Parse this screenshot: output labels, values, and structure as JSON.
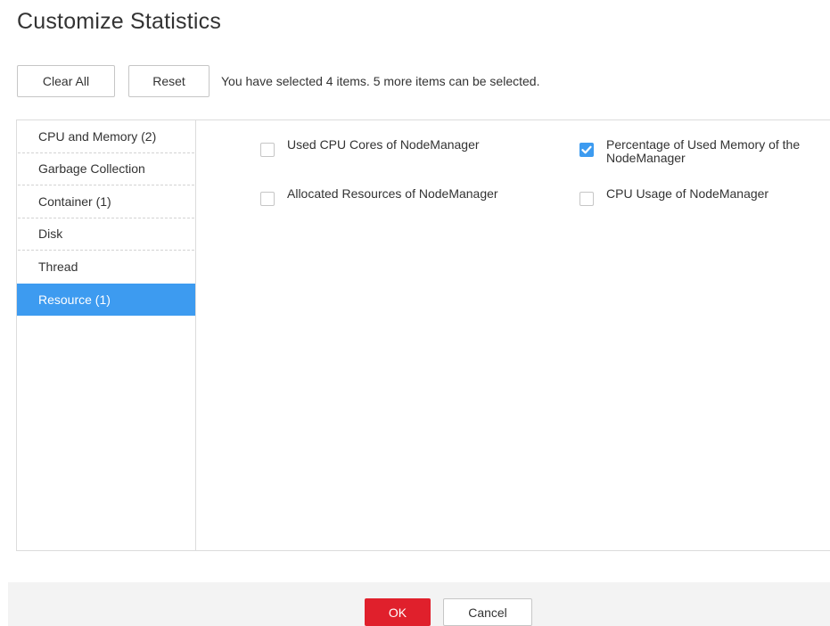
{
  "dialog": {
    "title": "Customize Statistics"
  },
  "toolbar": {
    "clear_all_label": "Clear All",
    "reset_label": "Reset",
    "selection_hint": "You have selected 4 items. 5 more items can be selected."
  },
  "categories": [
    {
      "label": "CPU and Memory (2)",
      "active": false
    },
    {
      "label": "Garbage Collection",
      "active": false
    },
    {
      "label": "Container (1)",
      "active": false
    },
    {
      "label": "Disk",
      "active": false
    },
    {
      "label": "Thread",
      "active": false
    },
    {
      "label": "Resource (1)",
      "active": true
    }
  ],
  "options": [
    {
      "label": "Used CPU Cores of NodeManager",
      "checked": false
    },
    {
      "label": "Percentage of Used Memory of the\nNodeManager",
      "checked": true
    },
    {
      "label": "Allocated Resources of NodeManager",
      "checked": false
    },
    {
      "label": "CPU Usage of NodeManager",
      "checked": false
    }
  ],
  "footer": {
    "ok_label": "OK",
    "cancel_label": "Cancel"
  },
  "colors": {
    "accent": "#3d9bf0",
    "primary_button": "#e0202c",
    "footer_background": "#f3f3f3"
  },
  "icons": {
    "checkbox_checked": "checkmark-icon"
  }
}
